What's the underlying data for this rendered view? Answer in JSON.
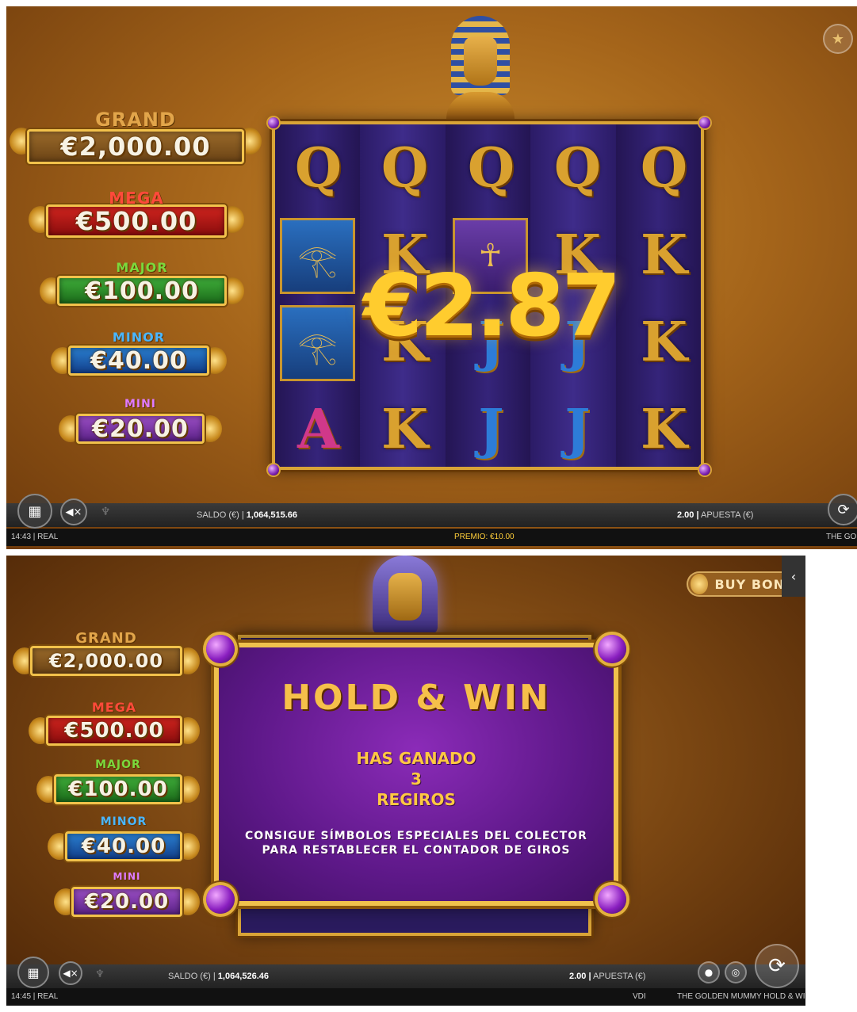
{
  "screen1": {
    "jackpots": [
      {
        "name": "GRAND",
        "value": "€2,000.00"
      },
      {
        "name": "MEGA",
        "value": "€500.00"
      },
      {
        "name": "MAJOR",
        "value": "€100.00"
      },
      {
        "name": "MINOR",
        "value": "€40.00"
      },
      {
        "name": "MINI",
        "value": "€20.00"
      }
    ],
    "reels": [
      [
        "Q",
        "Q",
        "Q",
        "Q",
        "Q"
      ],
      [
        "eye",
        "K",
        "ankh",
        "K",
        "K"
      ],
      [
        "eye",
        "K",
        "J",
        "J",
        "K"
      ],
      [
        "A",
        "K",
        "J",
        "J",
        "K"
      ]
    ],
    "win_amount": "€2.87",
    "controls": {
      "balance_label": "SALDO (€) |",
      "balance_value": "1,064,515.66",
      "bet_value": "2.00 |",
      "bet_label": "APUESTA (€)"
    },
    "info": {
      "time": "14:43 | REAL",
      "prize": "PREMIO: €10.00",
      "game": "THE GOL"
    }
  },
  "screen2": {
    "jackpots": [
      {
        "name": "GRAND",
        "value": "€2,000.00"
      },
      {
        "name": "MEGA",
        "value": "€500.00"
      },
      {
        "name": "MAJOR",
        "value": "€100.00"
      },
      {
        "name": "MINOR",
        "value": "€40.00"
      },
      {
        "name": "MINI",
        "value": "€20.00"
      }
    ],
    "buy_bonus": "BUY BONU",
    "sidetab_icon": "‹",
    "modal": {
      "title": "HOLD & WIN",
      "line1": "HAS GANADO",
      "line2": "3",
      "line3": "REGIROS",
      "sub1": "CONSIGUE SÍMBOLOS ESPECIALES DEL COLECTOR",
      "sub2": "PARA RESTABLECER EL CONTADOR DE GIROS"
    },
    "controls": {
      "balance_label": "SALDO (€) |",
      "balance_value": "1,064,526.46",
      "bet_value": "2.00 |",
      "bet_label": "APUESTA (€)"
    },
    "info": {
      "time": "14:45 | REAL",
      "middle": "VDI",
      "game": "THE GOLDEN MUMMY HOLD & WIN"
    }
  },
  "colors": {
    "gold": "#f0c14c",
    "modal_purple": "#5d1888",
    "prize_yellow": "#ffcf3a"
  },
  "icons": {
    "menu": "grid-icon",
    "sound": "speaker-muted-icon",
    "trophy": "trophy-icon",
    "spin": "spin-icon",
    "star": "star-icon"
  }
}
